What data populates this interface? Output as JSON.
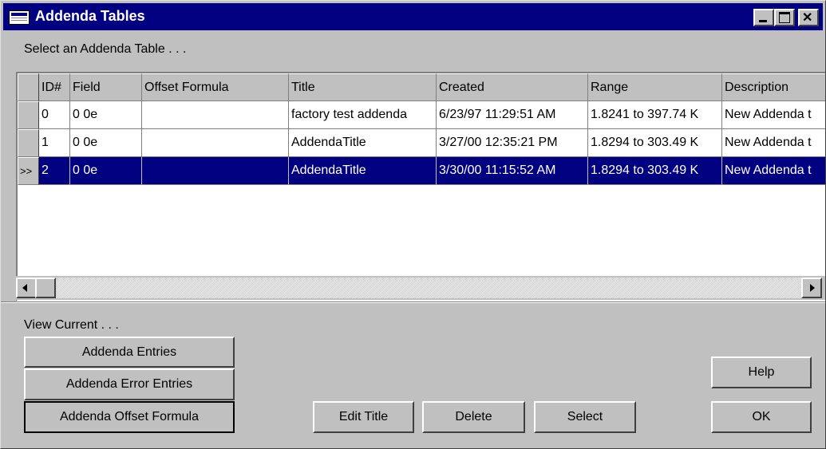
{
  "window": {
    "title": "Addenda Tables",
    "icon": "window-app-icon",
    "controls": [
      "minimize-icon",
      "maximize-icon",
      "close-icon"
    ]
  },
  "prompt": "Select an Addenda Table . . .",
  "table": {
    "columns": [
      "ID#",
      "Field",
      "Offset Formula",
      "Title",
      "Created",
      "Range",
      "Description"
    ],
    "rows": [
      {
        "id": "0",
        "field": "0 0e",
        "offset": "",
        "title": "factory test addenda",
        "created": "6/23/97 11:29:51 AM",
        "range": "1.8241 to 397.74 K",
        "description": "New Addenda t"
      },
      {
        "id": "1",
        "field": "0 0e",
        "offset": "",
        "title": "AddendaTitle",
        "created": "3/27/00 12:35:21 PM",
        "range": "1.8294 to 303.49 K",
        "description": "New Addenda t"
      },
      {
        "id": "2",
        "field": "0 0e",
        "offset": "",
        "title": "AddendaTitle",
        "created": "3/30/00 11:15:52 AM",
        "range": "1.8294 to 303.49 K",
        "description": "New Addenda t"
      }
    ],
    "current_row_marker": ">>",
    "selected_row_index": 2
  },
  "view_current": {
    "label": "View Current . . .",
    "buttons": [
      "Addenda Entries",
      "Addenda Error Entries",
      "Addenda Offset Formula"
    ]
  },
  "actions": {
    "edit_title": "Edit Title",
    "delete": "Delete",
    "select": "Select",
    "help": "Help",
    "ok": "OK"
  },
  "colors": {
    "face": "#c0c0c0",
    "titlebar": "#000080",
    "selection": "#000080"
  }
}
